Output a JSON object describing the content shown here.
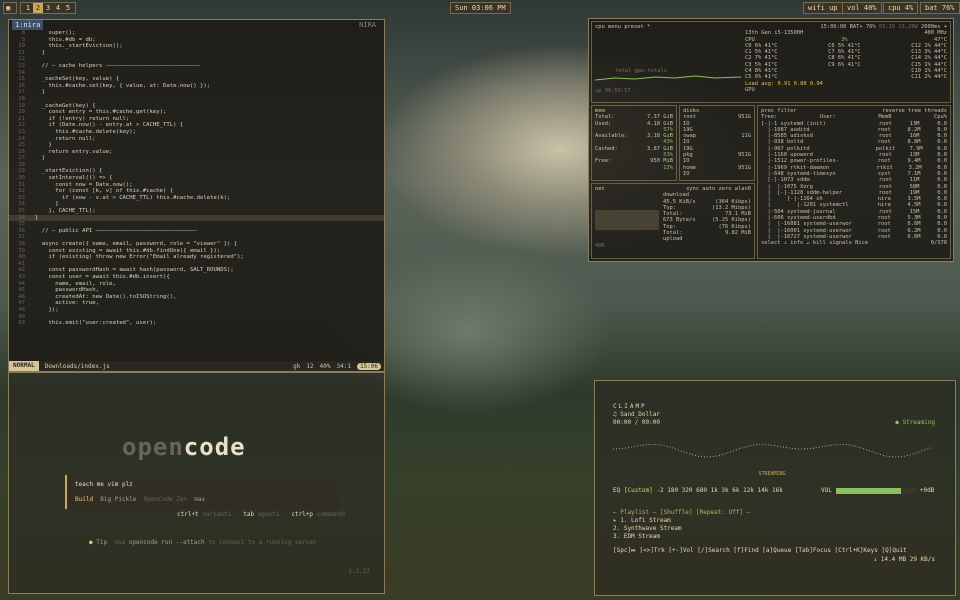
{
  "topbar": {
    "workspaces": [
      "1",
      "2",
      "3",
      "4",
      "5"
    ],
    "active_ws": 1,
    "clock": "Sun 03:06 PM",
    "wifi": "wifi up",
    "vol": "vol 40%",
    "cpu": "cpu 4%",
    "bat": "bat 76%"
  },
  "editor": {
    "tab": "1:nira",
    "filename": "nira",
    "right_label": "NIRA",
    "lines": [
      [
        "8",
        "    super();"
      ],
      [
        "9",
        "    this.#db = db;"
      ],
      [
        "10",
        "    this._startEviction();"
      ],
      [
        "11",
        "  }"
      ],
      [
        "12",
        ""
      ],
      [
        "13",
        "  // — cache helpers ————————————————————————————"
      ],
      [
        "14",
        ""
      ],
      [
        "15",
        "  _cacheSet(key, value) {"
      ],
      [
        "16",
        "    this.#cache.set(key, { value, at: Date.now() });"
      ],
      [
        "17",
        "  }"
      ],
      [
        "18",
        ""
      ],
      [
        "19",
        "  _cacheGet(key) {"
      ],
      [
        "20",
        "    const entry = this.#cache.get(key);"
      ],
      [
        "21",
        "    if (!entry) return null;"
      ],
      [
        "22",
        "    if (Date.now() - entry.at > CACHE_TTL) {"
      ],
      [
        "23",
        "      this.#cache.delete(key);"
      ],
      [
        "24",
        "      return null;"
      ],
      [
        "25",
        "    }"
      ],
      [
        "26",
        "    return entry.value;"
      ],
      [
        "27",
        "  }"
      ],
      [
        "28",
        ""
      ],
      [
        "29",
        "  _startEviction() {"
      ],
      [
        "30",
        "    setInterval(() => {"
      ],
      [
        "31",
        "      const now = Date.now();"
      ],
      [
        "32",
        "      for (const [k, v] of this.#cache) {"
      ],
      [
        "33",
        "        if (now - v.at > CACHE_TTL) this.#cache.delete(k);"
      ],
      [
        "34",
        "      }"
      ],
      [
        "35",
        "    }, CACHE_TTL);"
      ],
      [
        "34",
        "}"
      ],
      [
        "35",
        ""
      ],
      [
        "36",
        "  // — public API ——————————————————————————————"
      ],
      [
        "37",
        ""
      ],
      [
        "38",
        "  async create({ name, email, password, role = \"viewer\" }) {"
      ],
      [
        "39",
        "    const existing = await this.#db.findOne({ email });"
      ],
      [
        "40",
        "    if (existing) throw new Error(\"Email already registered\");"
      ],
      [
        "41",
        ""
      ],
      [
        "42",
        "    const passwordHash = await hash(password, SALT_ROUNDS);"
      ],
      [
        "43",
        "    const user = await this.#db.insert({"
      ],
      [
        "44",
        "      name, email, role,"
      ],
      [
        "45",
        "      passwordHash,"
      ],
      [
        "46",
        "      createdAt: new Date().toISOString(),"
      ],
      [
        "47",
        "      active: true,"
      ],
      [
        "48",
        "    });"
      ],
      [
        "49",
        ""
      ],
      [
        "50",
        "    this.emit(\"user:created\", user);"
      ]
    ],
    "status": {
      "mode": "NORMAL",
      "file": "Downloads/index.js",
      "branch": "gk",
      "diag": "12",
      "pct": "40%",
      "pos": "34:1",
      "time": "15:06"
    }
  },
  "opencode": {
    "logo_a": "open",
    "logo_b": "code",
    "prompt": "teach me vim plz",
    "build_label": "Build",
    "model": "Big Pickle",
    "provider": "OpenCode Zen",
    "variant": "max",
    "keys": [
      [
        "ctrl+t",
        "variants"
      ],
      [
        "tab",
        "agents"
      ],
      [
        "ctrl+p",
        "commands"
      ]
    ],
    "tip_label": "Tip",
    "tip_cmd": "opencode run --attach",
    "tip_text": "to connect to a running server",
    "version": "1.2.27"
  },
  "btop": {
    "cpu_hdr": "cpu",
    "menu": "menu",
    "preset": "preset *",
    "time": "15:06:00",
    "bat": "BAT+ 76%",
    "freq": "03:19 13.29W",
    "ghz": "2000ms +",
    "cpu_model": "13th Gen i5-13500H",
    "mhz": "400 MHz",
    "total": "total",
    "gpu_totals": "gpu-totals",
    "uptime": "up 06:55:57",
    "cores": [
      [
        "CPU",
        "",
        ""
      ],
      [
        "C0",
        "6%",
        "41°C"
      ],
      [
        "C1",
        "5%",
        "41°C"
      ],
      [
        "C2",
        "7%",
        "41°C"
      ],
      [
        "C3",
        "5%",
        "41°C"
      ],
      [
        "C4",
        "8%",
        "41°C"
      ],
      [
        "C5",
        "6%",
        "41°C"
      ],
      [
        "C6",
        "5%",
        "41°C"
      ],
      [
        "C7",
        "6%",
        "41°C"
      ],
      [
        "C8",
        "6%",
        "41°C"
      ],
      [
        "C9",
        "6%",
        "41°C"
      ],
      [
        "C10",
        "1%",
        "44°C"
      ],
      [
        "C11",
        "2%",
        "44°C"
      ],
      [
        "C12",
        "1%",
        "44°C"
      ],
      [
        "C13",
        "3%",
        "44°C"
      ],
      [
        "C14",
        "1%",
        "44°C"
      ],
      [
        "C15",
        "1%",
        "44°C"
      ]
    ],
    "cpu_pct": "3%",
    "cpu_temp": "47°C",
    "load": "Load avg: 0.91 0.88 0.94",
    "gpu": "GPU",
    "mem": [
      [
        "Total:",
        "7.37 GiB"
      ],
      [
        "Used:",
        "4.18 GiB"
      ],
      [
        "",
        "57%"
      ],
      [
        "Available:",
        "3.18 GiB"
      ],
      [
        "",
        "43%"
      ],
      [
        "Cached:",
        "3.87 GiB"
      ],
      [
        "",
        "53%"
      ],
      [
        "Free:",
        "950 MiB"
      ],
      [
        "",
        "13%"
      ]
    ],
    "disks": [
      [
        "root",
        "951G"
      ],
      [
        "IO",
        ""
      ],
      [
        "19G",
        ""
      ],
      [
        "swap",
        "11G"
      ],
      [
        "IO",
        ""
      ],
      [
        "19G",
        ""
      ],
      [
        "pkg",
        "951G"
      ],
      [
        "IO",
        ""
      ],
      [
        "home",
        "951G"
      ],
      [
        "IO",
        ""
      ]
    ],
    "net_hdr": "net",
    "sync": "sync",
    "auto": "auto",
    "zero": "zero",
    "iface": "wlan0",
    "net": [
      [
        "download",
        ""
      ],
      [
        "45.5 KiB/s",
        "(364 Kibps)"
      ],
      [
        "Top:",
        "(13.2 Mibps)"
      ],
      [
        "Total:",
        "73.1 MiB"
      ],
      [
        "673 Byte/s",
        "(5.25 Kibps)"
      ],
      [
        "Top:",
        "(76 Kibps)"
      ],
      [
        "Total:",
        "9.82 MiB"
      ],
      [
        "upload",
        ""
      ]
    ],
    "net_scale": "40K",
    "proc_hdr": "proc",
    "filter": "filter",
    "reverse": "reverse",
    "tree": "tree",
    "threads": "threads",
    "procs": [
      [
        "[-]-1 systemd (init)",
        "root",
        "13M",
        "0.0"
      ],
      [
        "  |-1087 auditd",
        "root",
        "8.2M",
        "0.0"
      ],
      [
        "  |-8585 udisksd",
        "root",
        "16M",
        "0.0"
      ],
      [
        "  |-938 boltd",
        "root",
        "8.8M",
        "0.0"
      ],
      [
        "  |-967 polkitd",
        "polkit",
        "7.9M",
        "0.0"
      ],
      [
        "  |-1160 upowerd",
        "root",
        "13M",
        "0.0"
      ],
      [
        "  |-1512 power-profiles-",
        "root",
        "9.4M",
        "0.0"
      ],
      [
        "  |-1969 rtkit-daemon",
        "rtkit",
        "3.2M",
        "0.0"
      ],
      [
        "  |-648 systemd-timesyn",
        "syst",
        "7.1M",
        "0.0"
      ],
      [
        "  [-]-1073 sddm",
        "root",
        "11M",
        "0.0"
      ],
      [
        "  |  |-1075 Xorg",
        "root",
        "58M",
        "0.0"
      ],
      [
        "  |  [-]-1128 sddm-helper",
        "root",
        "19M",
        "0.0"
      ],
      [
        "  |     [-]-1164 sh",
        "nira",
        "3.5M",
        "0.0"
      ],
      [
        "  |        |-1201 systemctl",
        "nira",
        "4.5M",
        "0.0"
      ],
      [
        "  |-504 systemd-journal",
        "root",
        "15M",
        "0.0"
      ],
      [
        "  |-606 systemd-userdbd",
        "root",
        "5.3M",
        "0.0"
      ],
      [
        "  |  |-16081 systemd-userwor",
        "root",
        "6.6M",
        "0.0"
      ],
      [
        "  |  |-16001 systemd-userwor",
        "root",
        "6.2M",
        "0.0"
      ],
      [
        "  |  |-16727 systemd-userwor",
        "root",
        "6.6M",
        "0.0"
      ]
    ],
    "proc_footer": "select ↓ info ↵ kill signals Nice",
    "proc_count": "0/378",
    "proc_cols": [
      "Tree:",
      "User:",
      "MemB",
      "Cpu%"
    ]
  },
  "cliamp": {
    "title": "CLIAMP",
    "track": "♫ Sand_Dollar",
    "time": "00:00 / 00:00",
    "status": "● Streaming",
    "streaming": "STREAMING",
    "eq_label": "EQ",
    "eq_preset": "[Custom]",
    "eq_values": "-2 180 320 680 1k 3k 6k 12k 14k 16k",
    "vol_label": "VOL",
    "vol_db": "+0dB",
    "vol_level": 0.82,
    "playlist_hdr": "— Playlist — [Shuffle] [Repeat: Off] —",
    "playlist": [
      "▸ 1. Lofi Stream",
      "  2. Synthwave Stream",
      "  3. EDM Stream"
    ],
    "help": "[Spc]⏯ [<>]Trk [+-]Vol [/]Search [f]Find [a]Queue [Tab]Focus [Ctrl+K]Keys [Q]Quit",
    "down": "↓ 14.4 MB  29 KB/s"
  }
}
